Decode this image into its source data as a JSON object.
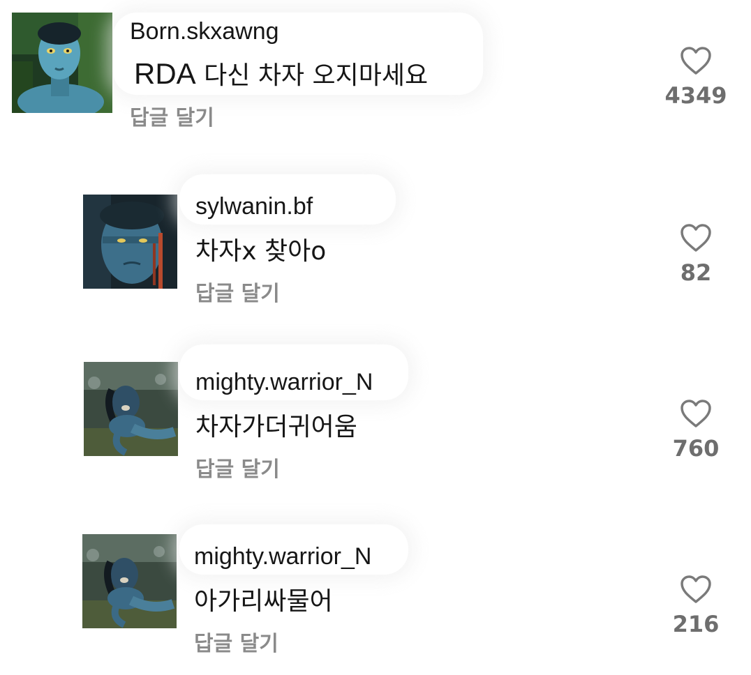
{
  "comments": [
    {
      "username": "Born.skxawng",
      "text_lead": "RDA",
      "text_rest": " 다신 차자 오지마세요",
      "reply_label": "답글 달기",
      "like_count": "4349",
      "avatar_icon": "avatar-navi-portrait"
    },
    {
      "username": "sylwanin.bf",
      "text_lead": "",
      "text_rest": "차자x 찾아o",
      "reply_label": "답글 달기",
      "like_count": "82",
      "avatar_icon": "avatar-navi-closeup"
    },
    {
      "username": "mighty.warrior_N",
      "text_lead": "",
      "text_rest": "차자가더귀어움",
      "reply_label": "답글 달기",
      "like_count": "760",
      "avatar_icon": "avatar-navi-warrior"
    },
    {
      "username": "mighty.warrior_N",
      "text_lead": "",
      "text_rest": "아가리싸물어",
      "reply_label": "답글 달기",
      "like_count": "216",
      "avatar_icon": "avatar-navi-warrior"
    }
  ],
  "colors": {
    "text": "#161616",
    "muted": "#8a8a8a",
    "like_count": "#6e6e6e",
    "heart_outline": "#7a7a7a"
  }
}
